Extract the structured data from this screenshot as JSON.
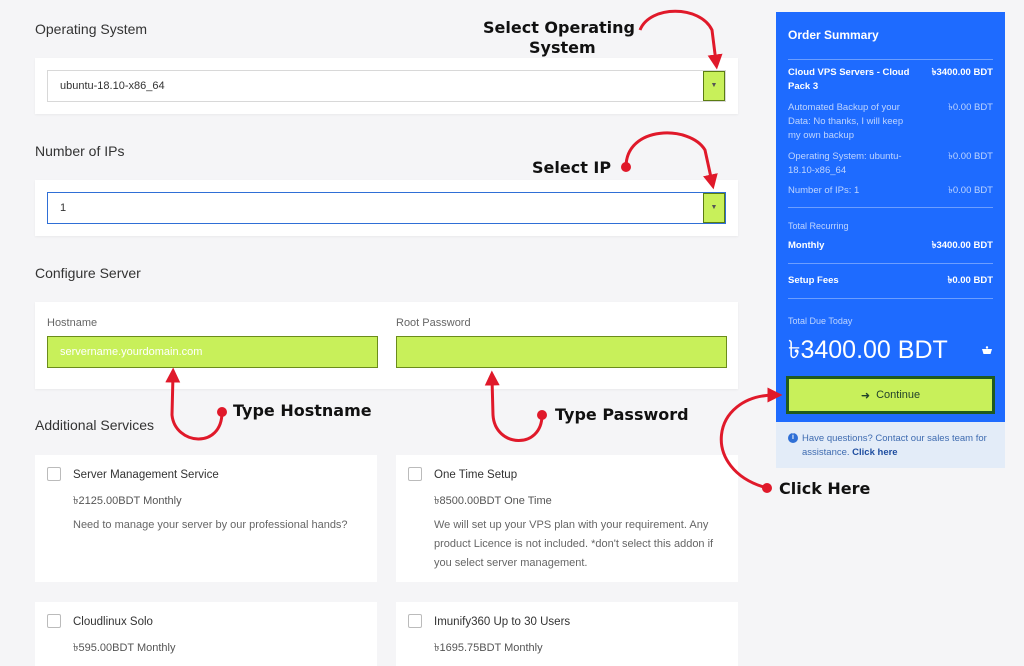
{
  "sections": {
    "operating_system": "Operating System",
    "number_of_ips": "Number of IPs",
    "configure_server": "Configure Server",
    "additional_services": "Additional Services"
  },
  "os_select": {
    "value": "ubuntu-18.10-x86_64"
  },
  "ip_select": {
    "value": "1"
  },
  "configure": {
    "hostname_label": "Hostname",
    "hostname_placeholder": "servername.yourdomain.com",
    "password_label": "Root Password"
  },
  "services": [
    {
      "title": "Server Management Service",
      "price": "৳2125.00BDT Monthly",
      "desc": "Need to manage your server by our professional hands?"
    },
    {
      "title": "One Time Setup",
      "price": "৳8500.00BDT One Time",
      "desc": "We will set up your VPS plan with your requirement. Any product Licence is not included. *don't select this addon if you select server management."
    },
    {
      "title": "Cloudlinux Solo",
      "price": "৳595.00BDT Monthly",
      "desc": ""
    },
    {
      "title": "Imunify360 Up to 30 Users",
      "price": "৳1695.75BDT Monthly",
      "desc": ""
    }
  ],
  "summary": {
    "title": "Order Summary",
    "rows": [
      {
        "label": "Cloud VPS Servers - Cloud Pack 3",
        "value": "৳3400.00 BDT"
      },
      {
        "label": "Automated Backup of your Data: No thanks, I will keep my own backup",
        "value": "৳0.00 BDT"
      },
      {
        "label": "Operating System: ubuntu-18.10-x86_64",
        "value": "৳0.00 BDT"
      },
      {
        "label": "Number of IPs: 1",
        "value": "৳0.00 BDT"
      }
    ],
    "total_recurring_label": "Total Recurring",
    "monthly_label": "Monthly",
    "monthly_value": "৳3400.00 BDT",
    "setup_label": "Setup Fees",
    "setup_value": "৳0.00 BDT",
    "total_due_label": "Total Due Today",
    "total_due_amount": "৳3400.00 BDT",
    "continue_label": "Continue"
  },
  "help": {
    "text": "Have questions? Contact our sales team for assistance.",
    "link": "Click here"
  },
  "annotations": {
    "select_os_line1": "Select Operating",
    "select_os_line2": "System",
    "select_ip": "Select IP",
    "type_hostname": "Type Hostname",
    "type_password": "Type Password",
    "click_here": "Click Here"
  },
  "colors": {
    "accent_blue": "#1e6bff",
    "highlight_green": "#c8f05a",
    "arrow_red": "#e0192a"
  }
}
